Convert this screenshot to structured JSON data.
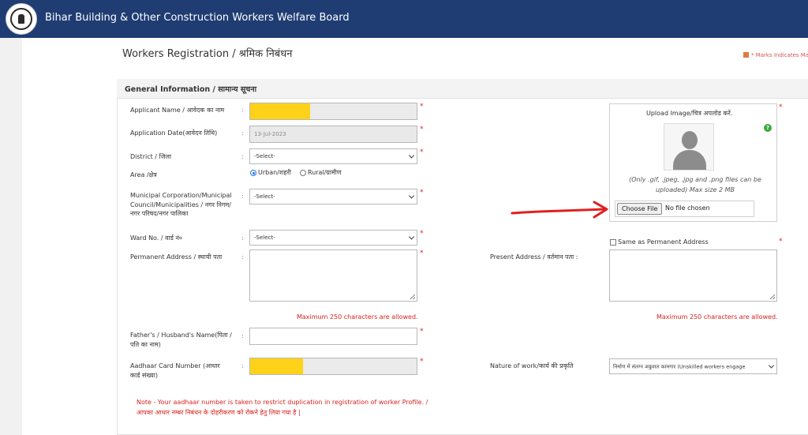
{
  "header": {
    "title": "Bihar Building & Other Construction Workers Welfare Board"
  },
  "page": {
    "title": "Workers Registration / श्रमिक निबंधन",
    "marks_note": "* Marks Indicates Ma"
  },
  "section": {
    "title": "General Information / सामान्य सूचना"
  },
  "fields": {
    "applicant_name": {
      "label": "Applicant Name / आवेदक का नाम",
      "value": ""
    },
    "application_date": {
      "label": "Application Date(आवेदन तिथि)",
      "value": "13-Jul-2023"
    },
    "district": {
      "label": "District / जिला",
      "value": "-Select-"
    },
    "area": {
      "label": "Area /क्षेत्र",
      "options": [
        "Urban/शहरी",
        "Rural/ग्रामीण"
      ],
      "selected": "Urban/शहरी"
    },
    "municipal": {
      "label_line1": "Municipal Corporation/Municipal",
      "label_line2": "Council/Municipalities / नगर निगम/",
      "label_line3": "नगर परिषद/नगर पालिका",
      "value": "-Select-"
    },
    "ward": {
      "label": "Ward No. / वार्ड नं०",
      "value": "-Select-"
    },
    "permanent_address": {
      "label": "Permanent Address / स्थायी पता",
      "value": ""
    },
    "present_address": {
      "label": "Present Address / वर्तमान पता :",
      "value": ""
    },
    "same_as_permanent": {
      "label": "Same as Permanent Address",
      "checked": false
    },
    "max_chars": "Maximum 250 characters are allowed.",
    "father_name": {
      "label_line1": "Father's / Husband's Name(पिता /",
      "label_line2": "पति का नाम)",
      "value": ""
    },
    "aadhaar": {
      "label_line1": "Aadhaar Card Number (आधार",
      "label_line2": "कार्ड संख्या)",
      "value": ""
    },
    "nature_of_work": {
      "label": "Nature of work/कार्य की प्रकृति",
      "value": "निर्माण में संलग्न अकुशल कामगार (Unskilled workers engage"
    }
  },
  "upload": {
    "label": "Upload Image/चित्र अपलोड करें.",
    "note": "(Only .gif, .jpeg, .jpg and .png files can be uploaded) Max size 2 MB",
    "button": "Choose File",
    "status": "No file chosen",
    "help": "?"
  },
  "note": {
    "line1": "Note  - Your aadhaar number is taken to restrict duplication in registration of worker Profile. /",
    "line2": "आपका आधार नम्बर निबंधन के दोहरीकरण को रोकने हेतु लिया गया है |"
  },
  "common": {
    "colon": ":",
    "required": "*"
  },
  "colors": {
    "header": "#1f3d73",
    "required": "#e02020",
    "highlight": "#ffd21a",
    "annotation_arrow": "#e02020"
  },
  "icons": {
    "logo": "bihar-emblem-logo",
    "avatar": "user-silhouette-icon",
    "help": "help-icon",
    "arrow": "red-arrow-annotation"
  }
}
